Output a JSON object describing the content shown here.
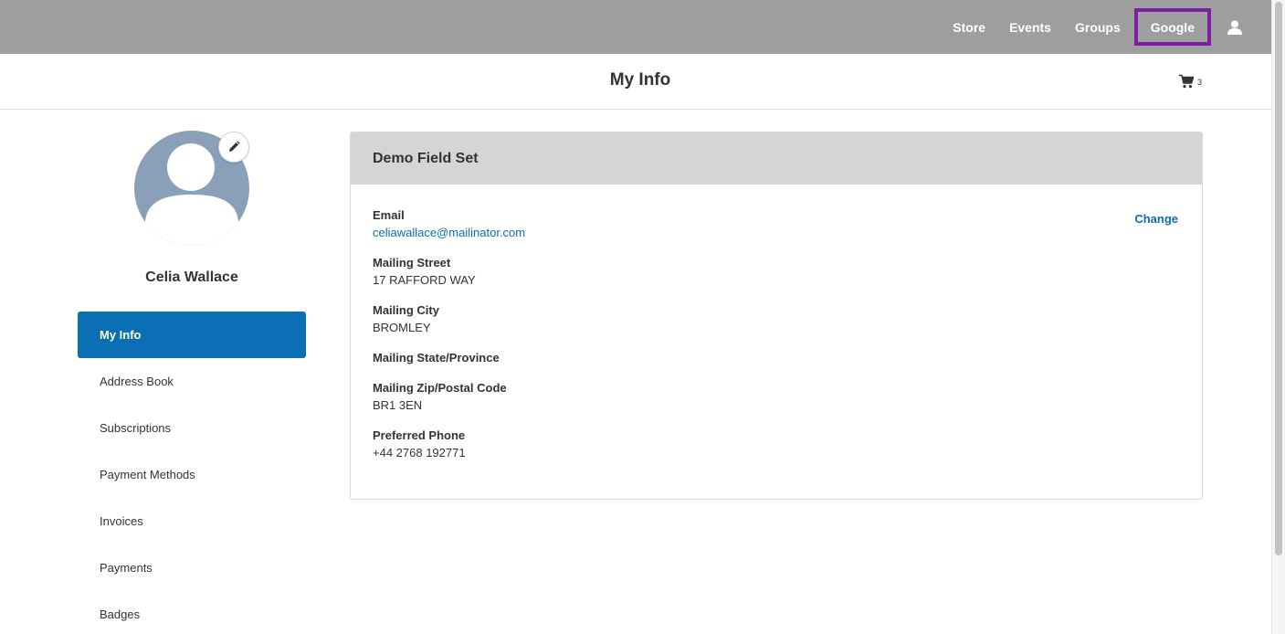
{
  "nav": {
    "items": [
      "Store",
      "Events",
      "Groups",
      "Google"
    ],
    "user_icon": "user-icon"
  },
  "header": {
    "title": "My Info",
    "cart_icon": "cart-icon",
    "cart_count": "3"
  },
  "profile": {
    "name": "Celia Wallace",
    "edit_icon": "pencil-icon"
  },
  "sidebar": {
    "items": [
      "My Info",
      "Address Book",
      "Subscriptions",
      "Payment Methods",
      "Invoices",
      "Payments",
      "Badges"
    ],
    "active": "My Info"
  },
  "panel": {
    "title": "Demo Field Set",
    "change_label": "Change",
    "fields": [
      {
        "label": "Email",
        "value": "celiawallace@mailinator.com"
      },
      {
        "label": "Mailing Street",
        "value": "17 RAFFORD WAY"
      },
      {
        "label": "Mailing City",
        "value": "BROMLEY"
      },
      {
        "label": "Mailing State/Province",
        "value": ""
      },
      {
        "label": "Mailing Zip/Postal Code",
        "value": "BR1 3EN"
      },
      {
        "label": "Preferred Phone",
        "value": "+44 2768 192771"
      }
    ]
  },
  "colors": {
    "topbar": "#9e9e9e",
    "accent": "#0a6fb5",
    "highlight": "#7b1fa2",
    "panel_header": "#d5d5d5",
    "avatar": "#8aa0b8"
  }
}
